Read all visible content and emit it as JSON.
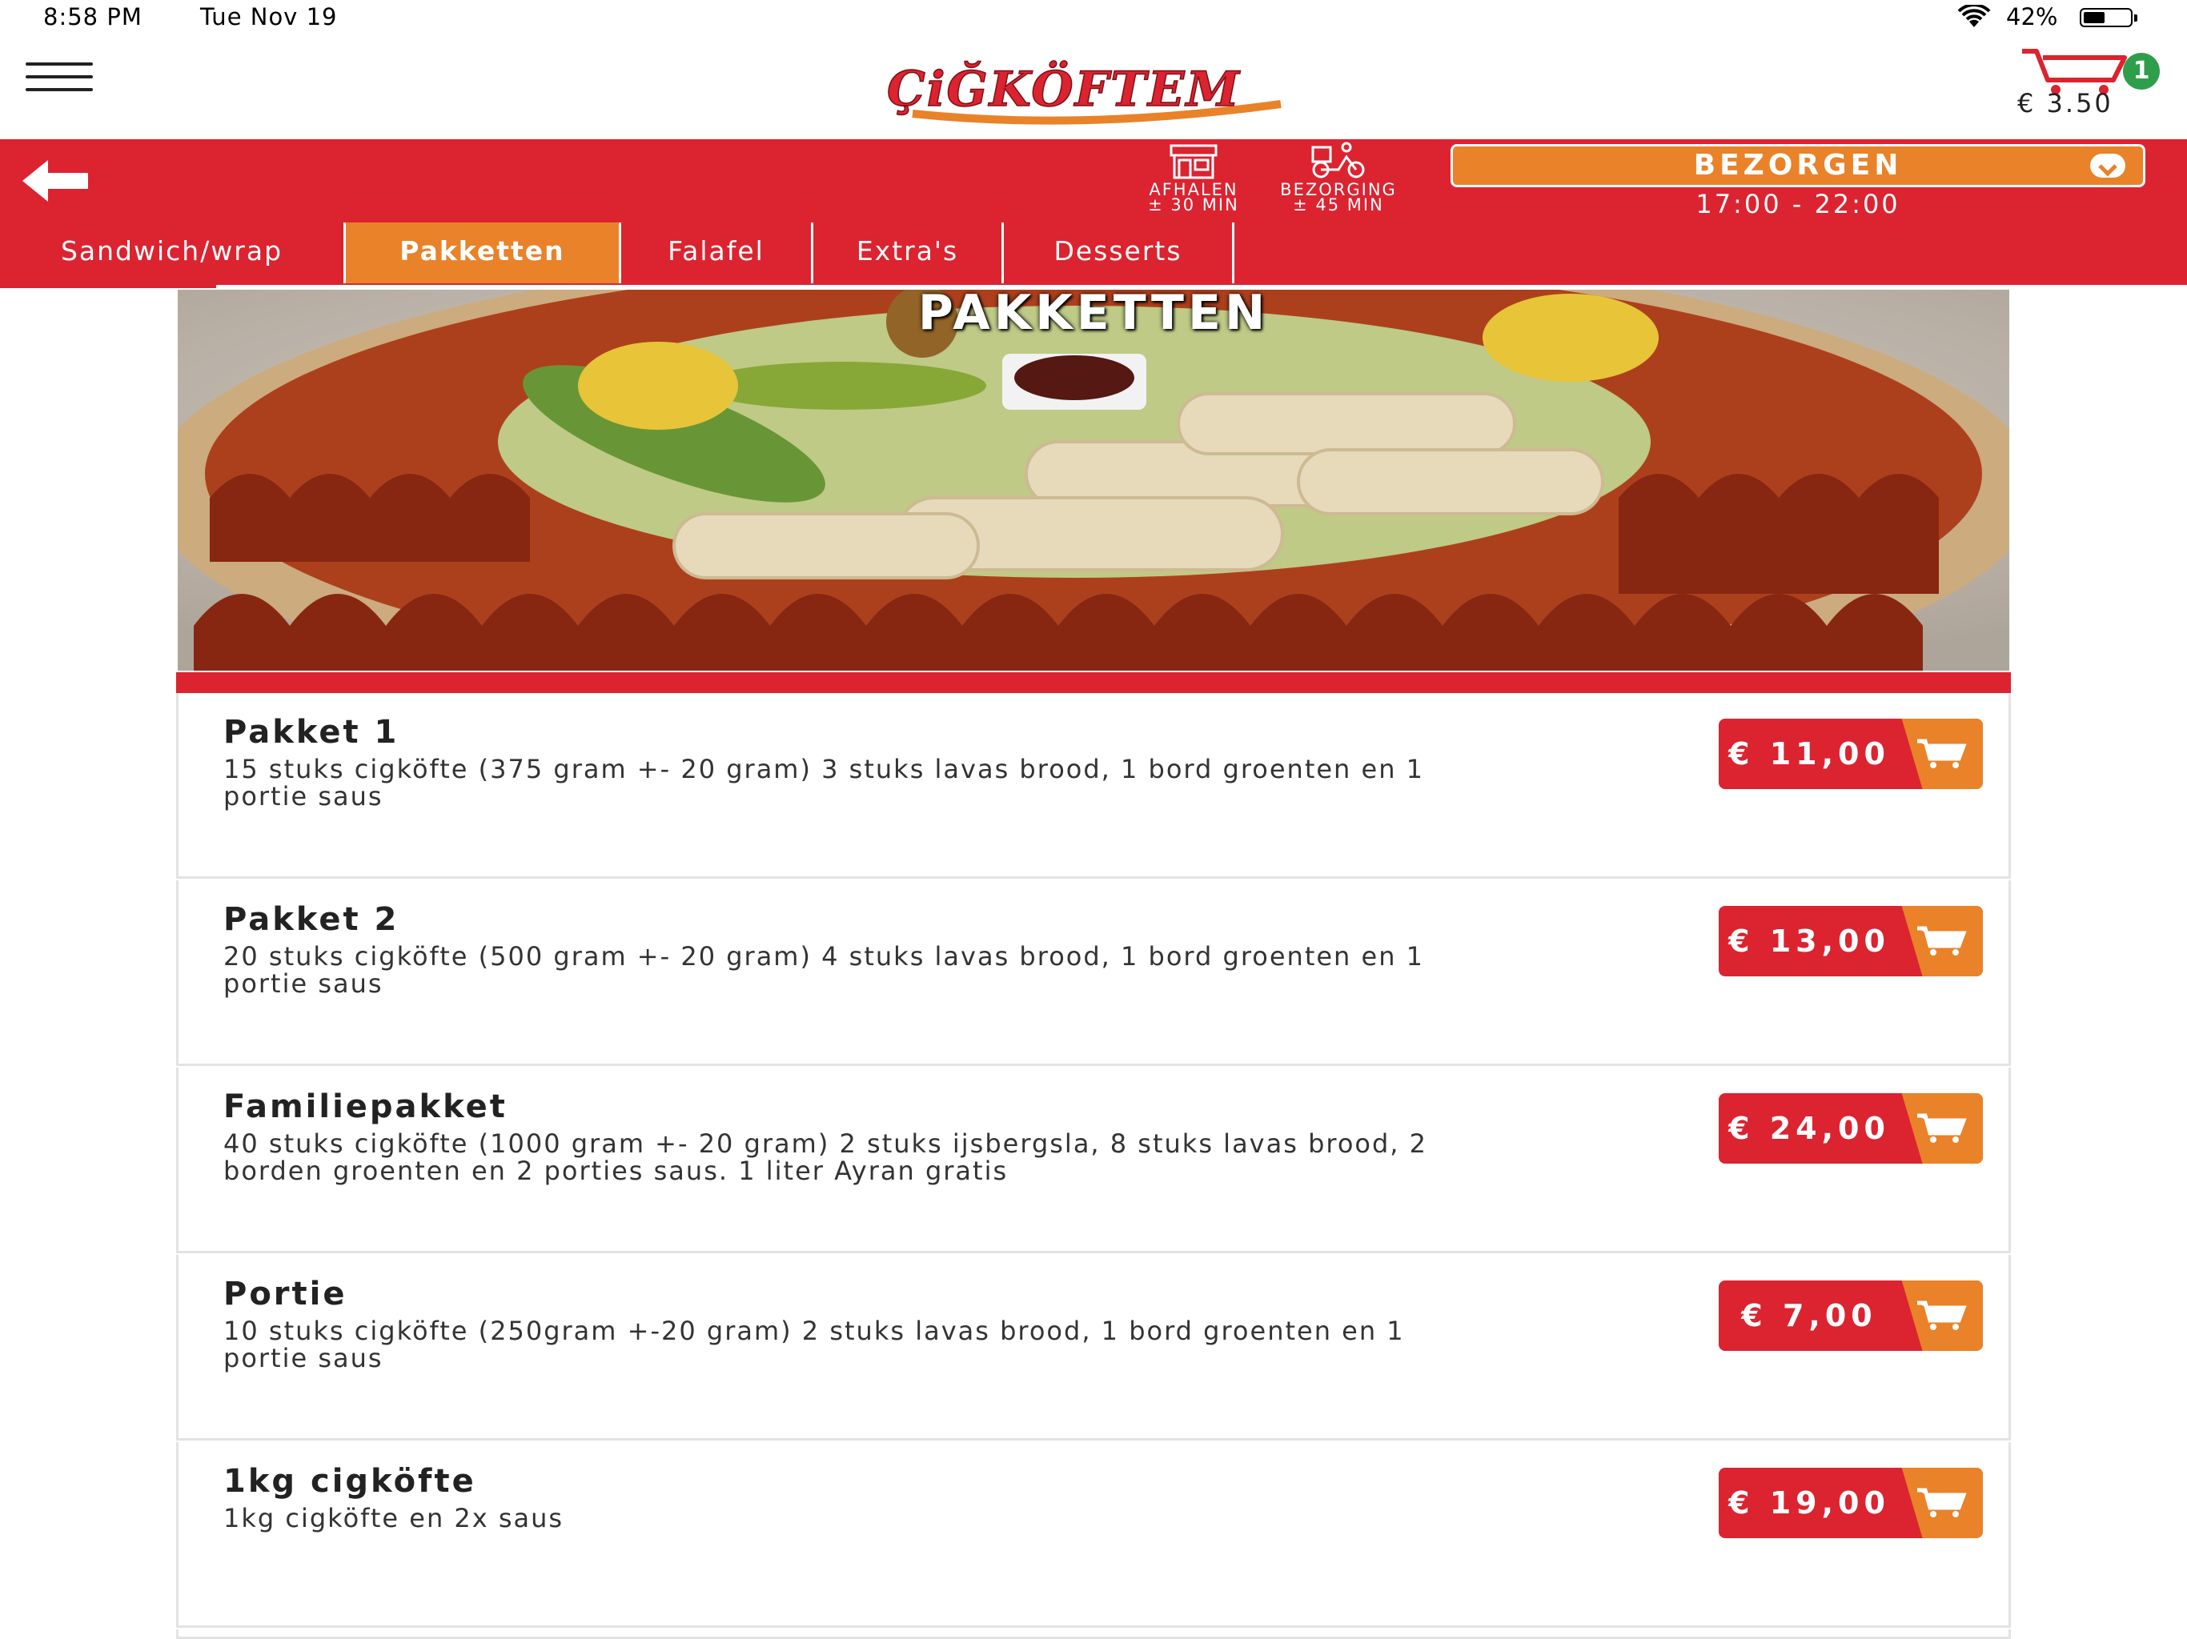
{
  "status_bar": {
    "time": "8:58 PM",
    "date": "Tue Nov 19",
    "battery": "42%",
    "battery_level": 0.42
  },
  "header": {
    "logo_text": "ÇiĞKÖFTEM",
    "cart_count": "1",
    "cart_total": "€ 3.50"
  },
  "service": {
    "afhalen_label": "AFHALEN",
    "afhalen_time": "± 30 MIN",
    "bezorging_label": "BEZORGING",
    "bezorging_time": "± 45 MIN",
    "selected_mode": "BEZORGEN",
    "hours": "17:00 - 22:00"
  },
  "tabs": [
    {
      "label": "Sandwich/wrap",
      "active": false
    },
    {
      "label": "Pakketten",
      "active": true
    },
    {
      "label": "Falafel",
      "active": false
    },
    {
      "label": "Extra's",
      "active": false
    },
    {
      "label": "Desserts",
      "active": false
    }
  ],
  "section": {
    "title": "PAKKETTEN"
  },
  "items": [
    {
      "name": "Pakket 1",
      "desc": "15 stuks cigköfte (375 gram +- 20 gram) 3 stuks lavas brood, 1 bord groenten en 1 portie saus",
      "price": "€ 11,00"
    },
    {
      "name": "Pakket 2",
      "desc": "20 stuks cigköfte (500 gram +- 20 gram) 4 stuks lavas brood, 1 bord groenten en 1 portie saus",
      "price": "€ 13,00"
    },
    {
      "name": "Familiepakket",
      "desc": "40 stuks cigköfte (1000 gram +- 20 gram) 2 stuks ijsbergsla, 8 stuks lavas brood, 2 borden groenten en 2 porties saus. 1 liter Ayran gratis",
      "price": "€ 24,00"
    },
    {
      "name": "Portie",
      "desc": "10 stuks cigköfte (250gram +-20 gram) 2 stuks lavas brood, 1 bord groenten en 1 portie saus",
      "price": "€ 7,00"
    },
    {
      "name": "1kg cigköfte",
      "desc": "1kg cigköfte en 2x saus",
      "price": "€ 19,00"
    }
  ],
  "colors": {
    "brand_red": "#dc2330",
    "brand_orange": "#e98228",
    "badge_green": "#2e9e4a"
  }
}
